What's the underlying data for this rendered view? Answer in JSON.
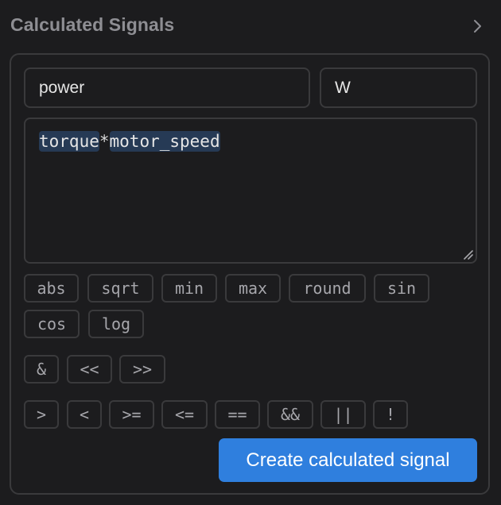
{
  "panel": {
    "title": "Calculated Signals",
    "chevron_icon": "chevron-right-icon"
  },
  "form": {
    "name_value": "power",
    "unit_value": "W",
    "expression": {
      "tokens": [
        {
          "text": "torque",
          "kind": "variable"
        },
        {
          "text": "*",
          "kind": "operator"
        },
        {
          "text": "motor_speed",
          "kind": "variable"
        }
      ]
    }
  },
  "functions": [
    "abs",
    "sqrt",
    "min",
    "max",
    "round",
    "sin",
    "cos",
    "log"
  ],
  "bitwise_ops": [
    "&",
    "<<",
    ">>"
  ],
  "comparison_ops": [
    ">",
    "<",
    ">=",
    "<=",
    "==",
    "&&",
    "||",
    "!"
  ],
  "actions": {
    "create_label": "Create calculated signal"
  },
  "colors": {
    "background": "#1c1c1e",
    "border": "#3a3a3c",
    "accent": "#2f7fde",
    "token_highlight": "#263a55"
  }
}
